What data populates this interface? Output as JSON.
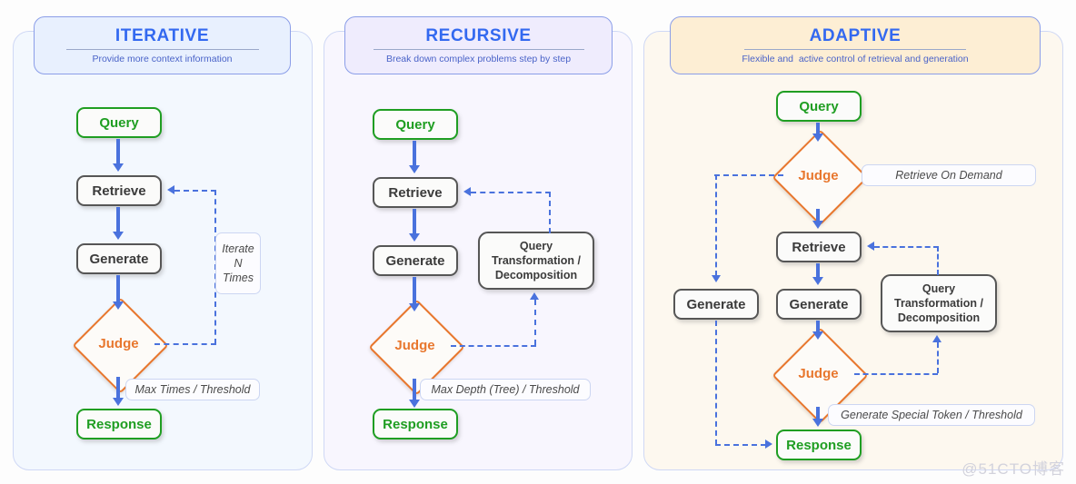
{
  "panels": [
    {
      "id": "iterative",
      "title": "ITERATIVE",
      "subtitle": "Provide more context information",
      "nodes": {
        "query": "Query",
        "retrieve": "Retrieve",
        "generate": "Generate",
        "judge": "Judge",
        "response": "Response"
      },
      "notes": {
        "loop": "Iterate\nN\nTimes",
        "loop_line1": "Iterate",
        "loop_line2": "N",
        "loop_line3": "Times",
        "exit": "Max Times / Threshold"
      }
    },
    {
      "id": "recursive",
      "title": "RECURSIVE",
      "subtitle": "Break down complex problems step by step",
      "nodes": {
        "query": "Query",
        "retrieve": "Retrieve",
        "generate": "Generate",
        "judge": "Judge",
        "response": "Response",
        "transform_line1": "Query",
        "transform_line2": "Transformation /",
        "transform_line3": "Decomposition"
      },
      "notes": {
        "exit": "Max Depth (Tree) / Threshold"
      }
    },
    {
      "id": "adaptive",
      "title": "ADAPTIVE",
      "subtitle": "Flexible and  active control of retrieval and generation",
      "nodes": {
        "query": "Query",
        "judge_top": "Judge",
        "retrieve": "Retrieve",
        "generate_left": "Generate",
        "generate_main": "Generate",
        "judge_bottom": "Judge",
        "response": "Response",
        "transform_line1": "Query",
        "transform_line2": "Transformation /",
        "transform_line3": "Decomposition"
      },
      "notes": {
        "on_demand": "Retrieve On  Demand",
        "exit": "Generate Special Token / Threshold"
      }
    }
  ],
  "watermark": "@51CTO博客",
  "colors": {
    "accent_blue": "#3369f0",
    "arrow_blue": "#4a72dd",
    "green": "#1f9e22",
    "orange": "#e8772e",
    "grey_node": "#565656"
  }
}
